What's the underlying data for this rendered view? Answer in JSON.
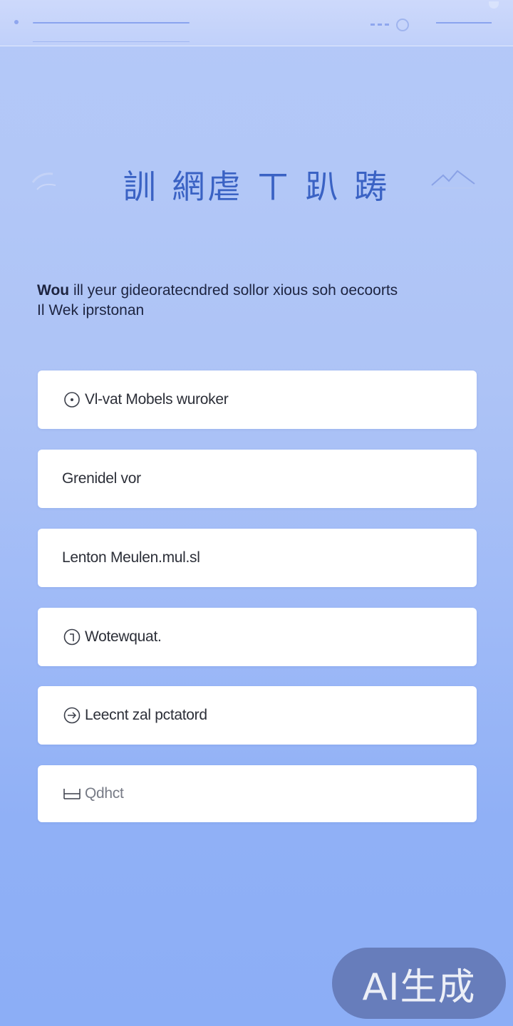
{
  "title": "訓 網虐 ㄒ 趴 踌",
  "subtitle": {
    "lead": "Wou",
    "text": " ill yeur gideoratecndred sollor xious soh oecoorts",
    "line2": "Il Wek iprstonan"
  },
  "options": [
    {
      "icon": "clock-icon",
      "label": "Vl-vat Mobels wuroker"
    },
    {
      "icon": "",
      "label": "Grenidel vor"
    },
    {
      "icon": "",
      "label": "Lenton Meulen.mul.sl"
    },
    {
      "icon": "info-icon",
      "label": "Wotewquat."
    },
    {
      "icon": "chat-icon",
      "label": "Leecnt zal pctatord"
    },
    {
      "icon": "box-icon",
      "label": "Qdhct"
    }
  ],
  "badge": "AI生成",
  "colors": {
    "accent": "#3a62c4",
    "card": "#ffffff",
    "background_top": "#b4c8f8",
    "background_bottom": "#8caef6"
  }
}
